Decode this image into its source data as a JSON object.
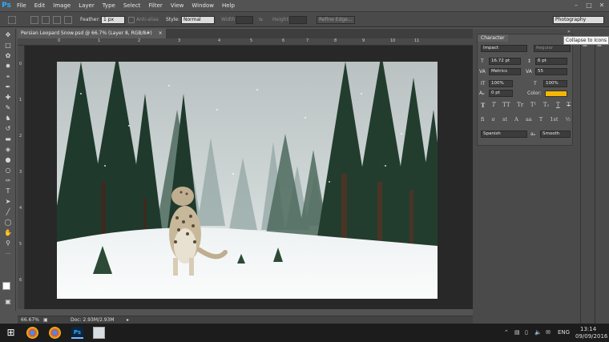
{
  "app": {
    "logo": "Ps",
    "menu": [
      "File",
      "Edit",
      "Image",
      "Layer",
      "Type",
      "Select",
      "Filter",
      "View",
      "Window",
      "Help"
    ]
  },
  "options_bar": {
    "feather_label": "Feather:",
    "feather_value": "1 px",
    "antialias_label": "Anti-alias",
    "style_label": "Style:",
    "style_value": "Normal",
    "width_label": "Width:",
    "height_label": "Height:",
    "refine_edge": "Refine Edge...",
    "workspace": "Photography"
  },
  "document": {
    "tab_title": "Persian Leopard Snow.psd @ 66.7% (Layer 8, RGB/8#)",
    "ruler_top": [
      "0",
      "1",
      "2",
      "3",
      "4",
      "5",
      "6",
      "7",
      "8",
      "9",
      "10",
      "11"
    ],
    "ruler_left": [
      "0",
      "1",
      "2",
      "3",
      "4",
      "5",
      "6"
    ]
  },
  "status_bar": {
    "zoom": "66.67%",
    "doc_info": "Doc: 2.93M/2.93M"
  },
  "character_panel": {
    "tab": "Character",
    "font_family": "Impact",
    "font_style": "Regular",
    "font_size": "16.72 pt",
    "leading": "6 pt",
    "kerning": "Metrics",
    "tracking": "55",
    "vertical_scale": "100%",
    "horizontal_scale": "100%",
    "baseline_shift": "0 pt",
    "color_label": "Color:",
    "color_value": "#f5b800",
    "type_styles": [
      "T",
      "T",
      "TT",
      "Tr",
      "T¹",
      "T₁",
      "T",
      "T"
    ],
    "opentype": [
      "fi",
      "σ",
      "st",
      "A",
      "aa",
      "T",
      "1st",
      "½"
    ],
    "language": "Spanish",
    "aa_label": "aₐ",
    "antialias_method": "Smooth"
  },
  "tooltip": "Collapse to Icons",
  "taskbar": {
    "lang": "ENG",
    "time": "13:14",
    "date": "09/09/2016"
  }
}
